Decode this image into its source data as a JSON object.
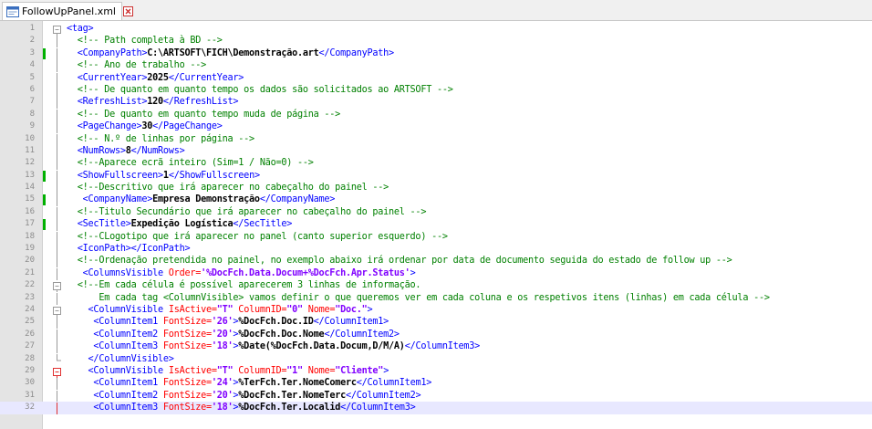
{
  "tab": {
    "filename": "FollowUpPanel.xml",
    "close_label": "×"
  },
  "icons": {
    "file": "xml-file-icon",
    "close": "close-icon",
    "fold": "fold-marker-icon"
  },
  "colors": {
    "tag": "#0000ff",
    "attribute": "#ff0000",
    "attr_value": "#8000ff",
    "comment": "#008000",
    "changed_marker": "#00b000",
    "current_line": "#e8e8ff"
  },
  "editor": {
    "lines": [
      {
        "n": "1",
        "fold": "open",
        "changed": false,
        "parts": [
          {
            "k": "t",
            "s": "<tag>"
          }
        ]
      },
      {
        "n": "2",
        "fold": "bar",
        "changed": false,
        "parts": [
          {
            "k": "p",
            "s": "  "
          },
          {
            "k": "c",
            "s": "<!-- Path completa à BD -->"
          }
        ]
      },
      {
        "n": "3",
        "fold": "bar",
        "changed": true,
        "parts": [
          {
            "k": "p",
            "s": "  "
          },
          {
            "k": "t",
            "s": "<CompanyPath>"
          },
          {
            "k": "b",
            "s": "C:\\ARTSOFT\\FICH\\Demonstração.art"
          },
          {
            "k": "t",
            "s": "</CompanyPath>"
          }
        ]
      },
      {
        "n": "4",
        "fold": "bar",
        "changed": false,
        "parts": [
          {
            "k": "p",
            "s": "  "
          },
          {
            "k": "c",
            "s": "<!-- Ano de trabalho -->"
          }
        ]
      },
      {
        "n": "5",
        "fold": "bar",
        "changed": false,
        "parts": [
          {
            "k": "p",
            "s": "  "
          },
          {
            "k": "t",
            "s": "<CurrentYear>"
          },
          {
            "k": "b",
            "s": "2025"
          },
          {
            "k": "t",
            "s": "</CurrentYear>"
          }
        ]
      },
      {
        "n": "6",
        "fold": "bar",
        "changed": false,
        "parts": [
          {
            "k": "p",
            "s": "  "
          },
          {
            "k": "c",
            "s": "<!-- De quanto em quanto tempo os dados são solicitados ao ARTSOFT -->"
          }
        ]
      },
      {
        "n": "7",
        "fold": "bar",
        "changed": false,
        "parts": [
          {
            "k": "p",
            "s": "  "
          },
          {
            "k": "t",
            "s": "<RefreshList>"
          },
          {
            "k": "b",
            "s": "120"
          },
          {
            "k": "t",
            "s": "</RefreshList>"
          }
        ]
      },
      {
        "n": "8",
        "fold": "bar",
        "changed": false,
        "parts": [
          {
            "k": "p",
            "s": "  "
          },
          {
            "k": "c",
            "s": "<!-- De quanto em quanto tempo muda de página -->"
          }
        ]
      },
      {
        "n": "9",
        "fold": "bar",
        "changed": false,
        "parts": [
          {
            "k": "p",
            "s": "  "
          },
          {
            "k": "t",
            "s": "<PageChange>"
          },
          {
            "k": "b",
            "s": "30"
          },
          {
            "k": "t",
            "s": "</PageChange>"
          }
        ]
      },
      {
        "n": "10",
        "fold": "bar",
        "changed": false,
        "parts": [
          {
            "k": "p",
            "s": "  "
          },
          {
            "k": "c",
            "s": "<!-- N.º de linhas por página -->"
          }
        ]
      },
      {
        "n": "11",
        "fold": "bar",
        "changed": false,
        "parts": [
          {
            "k": "p",
            "s": "  "
          },
          {
            "k": "t",
            "s": "<NumRows>"
          },
          {
            "k": "b",
            "s": "8"
          },
          {
            "k": "t",
            "s": "</NumRows>"
          }
        ]
      },
      {
        "n": "12",
        "fold": "bar",
        "changed": false,
        "parts": [
          {
            "k": "p",
            "s": "  "
          },
          {
            "k": "c",
            "s": "<!--Aparece ecrã inteiro (Sim=1 / Não=0) -->"
          }
        ]
      },
      {
        "n": "13",
        "fold": "bar",
        "changed": true,
        "parts": [
          {
            "k": "p",
            "s": "  "
          },
          {
            "k": "t",
            "s": "<ShowFullscreen>"
          },
          {
            "k": "b",
            "s": "1"
          },
          {
            "k": "t",
            "s": "</ShowFullscreen>"
          }
        ]
      },
      {
        "n": "14",
        "fold": "bar",
        "changed": false,
        "parts": [
          {
            "k": "p",
            "s": "  "
          },
          {
            "k": "c",
            "s": "<!--Descritivo que irá aparecer no cabeçalho do painel -->"
          }
        ]
      },
      {
        "n": "15",
        "fold": "bar",
        "changed": true,
        "parts": [
          {
            "k": "p",
            "s": "   "
          },
          {
            "k": "t",
            "s": "<CompanyName>"
          },
          {
            "k": "b",
            "s": "Empresa Demonstração"
          },
          {
            "k": "t",
            "s": "</CompanyName>"
          }
        ]
      },
      {
        "n": "16",
        "fold": "bar",
        "changed": false,
        "parts": [
          {
            "k": "p",
            "s": "  "
          },
          {
            "k": "c",
            "s": "<!--Titulo Secundário que irá aparecer no cabeçalho do painel -->"
          }
        ]
      },
      {
        "n": "17",
        "fold": "bar",
        "changed": true,
        "parts": [
          {
            "k": "p",
            "s": "  "
          },
          {
            "k": "t",
            "s": "<SecTitle>"
          },
          {
            "k": "b",
            "s": "Expedição Logística"
          },
          {
            "k": "t",
            "s": "</SecTitle>"
          }
        ]
      },
      {
        "n": "18",
        "fold": "bar",
        "changed": false,
        "parts": [
          {
            "k": "p",
            "s": "  "
          },
          {
            "k": "c",
            "s": "<!--CLogotipo que irá aparecer no panel (canto superior esquerdo) -->"
          }
        ]
      },
      {
        "n": "19",
        "fold": "bar",
        "changed": false,
        "parts": [
          {
            "k": "p",
            "s": "  "
          },
          {
            "k": "t",
            "s": "<IconPath></IconPath>"
          }
        ]
      },
      {
        "n": "20",
        "fold": "bar",
        "changed": false,
        "parts": [
          {
            "k": "p",
            "s": "  "
          },
          {
            "k": "c",
            "s": "<!--Ordenação pretendida no painel, no exemplo abaixo irá ordenar por data de documento seguida do estado de follow up -->"
          }
        ]
      },
      {
        "n": "21",
        "fold": "bar",
        "changed": false,
        "parts": [
          {
            "k": "p",
            "s": "   "
          },
          {
            "k": "t",
            "s": "<ColumnsVisible "
          },
          {
            "k": "a",
            "s": "Order="
          },
          {
            "k": "v",
            "s": "'%DocFch.Data.Docum+%DocFch.Apr.Status'"
          },
          {
            "k": "t",
            "s": ">"
          }
        ]
      },
      {
        "n": "22",
        "fold": "open",
        "changed": false,
        "parts": [
          {
            "k": "p",
            "s": "  "
          },
          {
            "k": "c",
            "s": "<!--Em cada célula é possível aparecerem 3 linhas de informação."
          }
        ]
      },
      {
        "n": "23",
        "fold": "bar",
        "changed": false,
        "parts": [
          {
            "k": "p",
            "s": "      "
          },
          {
            "k": "c",
            "s": "Em cada tag <ColumnVisible> vamos definir o que queremos ver em cada coluna e os respetivos itens (linhas) em cada célula -->"
          }
        ]
      },
      {
        "n": "24",
        "fold": "open",
        "changed": false,
        "parts": [
          {
            "k": "p",
            "s": "    "
          },
          {
            "k": "t",
            "s": "<ColumnVisible "
          },
          {
            "k": "a",
            "s": "IsActive="
          },
          {
            "k": "v",
            "s": "\"T\""
          },
          {
            "k": "a",
            "s": " ColumnID="
          },
          {
            "k": "v",
            "s": "\"0\""
          },
          {
            "k": "a",
            "s": " Nome="
          },
          {
            "k": "v",
            "s": "\"Doc.\""
          },
          {
            "k": "t",
            "s": ">"
          }
        ]
      },
      {
        "n": "25",
        "fold": "bar",
        "changed": false,
        "parts": [
          {
            "k": "p",
            "s": "     "
          },
          {
            "k": "t",
            "s": "<ColumnItem1 "
          },
          {
            "k": "a",
            "s": "FontSize="
          },
          {
            "k": "v",
            "s": "'26'"
          },
          {
            "k": "t",
            "s": ">"
          },
          {
            "k": "b",
            "s": "%DocFch.Doc.ID"
          },
          {
            "k": "t",
            "s": "</ColumnItem1>"
          }
        ]
      },
      {
        "n": "26",
        "fold": "bar",
        "changed": false,
        "parts": [
          {
            "k": "p",
            "s": "     "
          },
          {
            "k": "t",
            "s": "<ColumnItem2 "
          },
          {
            "k": "a",
            "s": "FontSize="
          },
          {
            "k": "v",
            "s": "'20'"
          },
          {
            "k": "t",
            "s": ">"
          },
          {
            "k": "b",
            "s": "%DocFch.Doc.Nome"
          },
          {
            "k": "t",
            "s": "</ColumnItem2>"
          }
        ]
      },
      {
        "n": "27",
        "fold": "bar",
        "changed": false,
        "parts": [
          {
            "k": "p",
            "s": "     "
          },
          {
            "k": "t",
            "s": "<ColumnItem3 "
          },
          {
            "k": "a",
            "s": "FontSize="
          },
          {
            "k": "v",
            "s": "'18'"
          },
          {
            "k": "t",
            "s": ">"
          },
          {
            "k": "b",
            "s": "%Date(%DocFch.Data.Docum,D/M/A)"
          },
          {
            "k": "t",
            "s": "</ColumnItem3>"
          }
        ]
      },
      {
        "n": "28",
        "fold": "end",
        "changed": false,
        "parts": [
          {
            "k": "p",
            "s": "    "
          },
          {
            "k": "t",
            "s": "</ColumnVisible>"
          }
        ]
      },
      {
        "n": "29",
        "fold": "open-red",
        "changed": false,
        "parts": [
          {
            "k": "p",
            "s": "    "
          },
          {
            "k": "t",
            "s": "<ColumnVisible "
          },
          {
            "k": "a",
            "s": "IsActive="
          },
          {
            "k": "v",
            "s": "\"T\""
          },
          {
            "k": "a",
            "s": " ColumnID="
          },
          {
            "k": "v",
            "s": "\"1\""
          },
          {
            "k": "a",
            "s": " Nome="
          },
          {
            "k": "v",
            "s": "\"Cliente\""
          },
          {
            "k": "t",
            "s": ">"
          }
        ]
      },
      {
        "n": "30",
        "fold": "bar",
        "changed": false,
        "parts": [
          {
            "k": "p",
            "s": "     "
          },
          {
            "k": "t",
            "s": "<ColumnItem1 "
          },
          {
            "k": "a",
            "s": "FontSize="
          },
          {
            "k": "v",
            "s": "'24'"
          },
          {
            "k": "t",
            "s": ">"
          },
          {
            "k": "b",
            "s": "%TerFch.Ter.NomeComerc"
          },
          {
            "k": "t",
            "s": "</ColumnItem1>"
          }
        ]
      },
      {
        "n": "31",
        "fold": "bar",
        "changed": false,
        "parts": [
          {
            "k": "p",
            "s": "     "
          },
          {
            "k": "t",
            "s": "<ColumnItem2 "
          },
          {
            "k": "a",
            "s": "FontSize="
          },
          {
            "k": "v",
            "s": "'20'"
          },
          {
            "k": "t",
            "s": ">"
          },
          {
            "k": "b",
            "s": "%DocFch.Ter.NomeTerc"
          },
          {
            "k": "t",
            "s": "</ColumnItem2>"
          }
        ]
      },
      {
        "n": "32",
        "fold": "bar-red",
        "changed": false,
        "current": true,
        "parts": [
          {
            "k": "p",
            "s": "     "
          },
          {
            "k": "t",
            "s": "<ColumnItem3 "
          },
          {
            "k": "a",
            "s": "FontSize="
          },
          {
            "k": "v",
            "s": "'18'"
          },
          {
            "k": "t",
            "s": ">"
          },
          {
            "k": "b",
            "s": "%DocFch.Ter.Localid"
          },
          {
            "k": "t",
            "s": "</ColumnItem3>"
          }
        ]
      }
    ]
  }
}
